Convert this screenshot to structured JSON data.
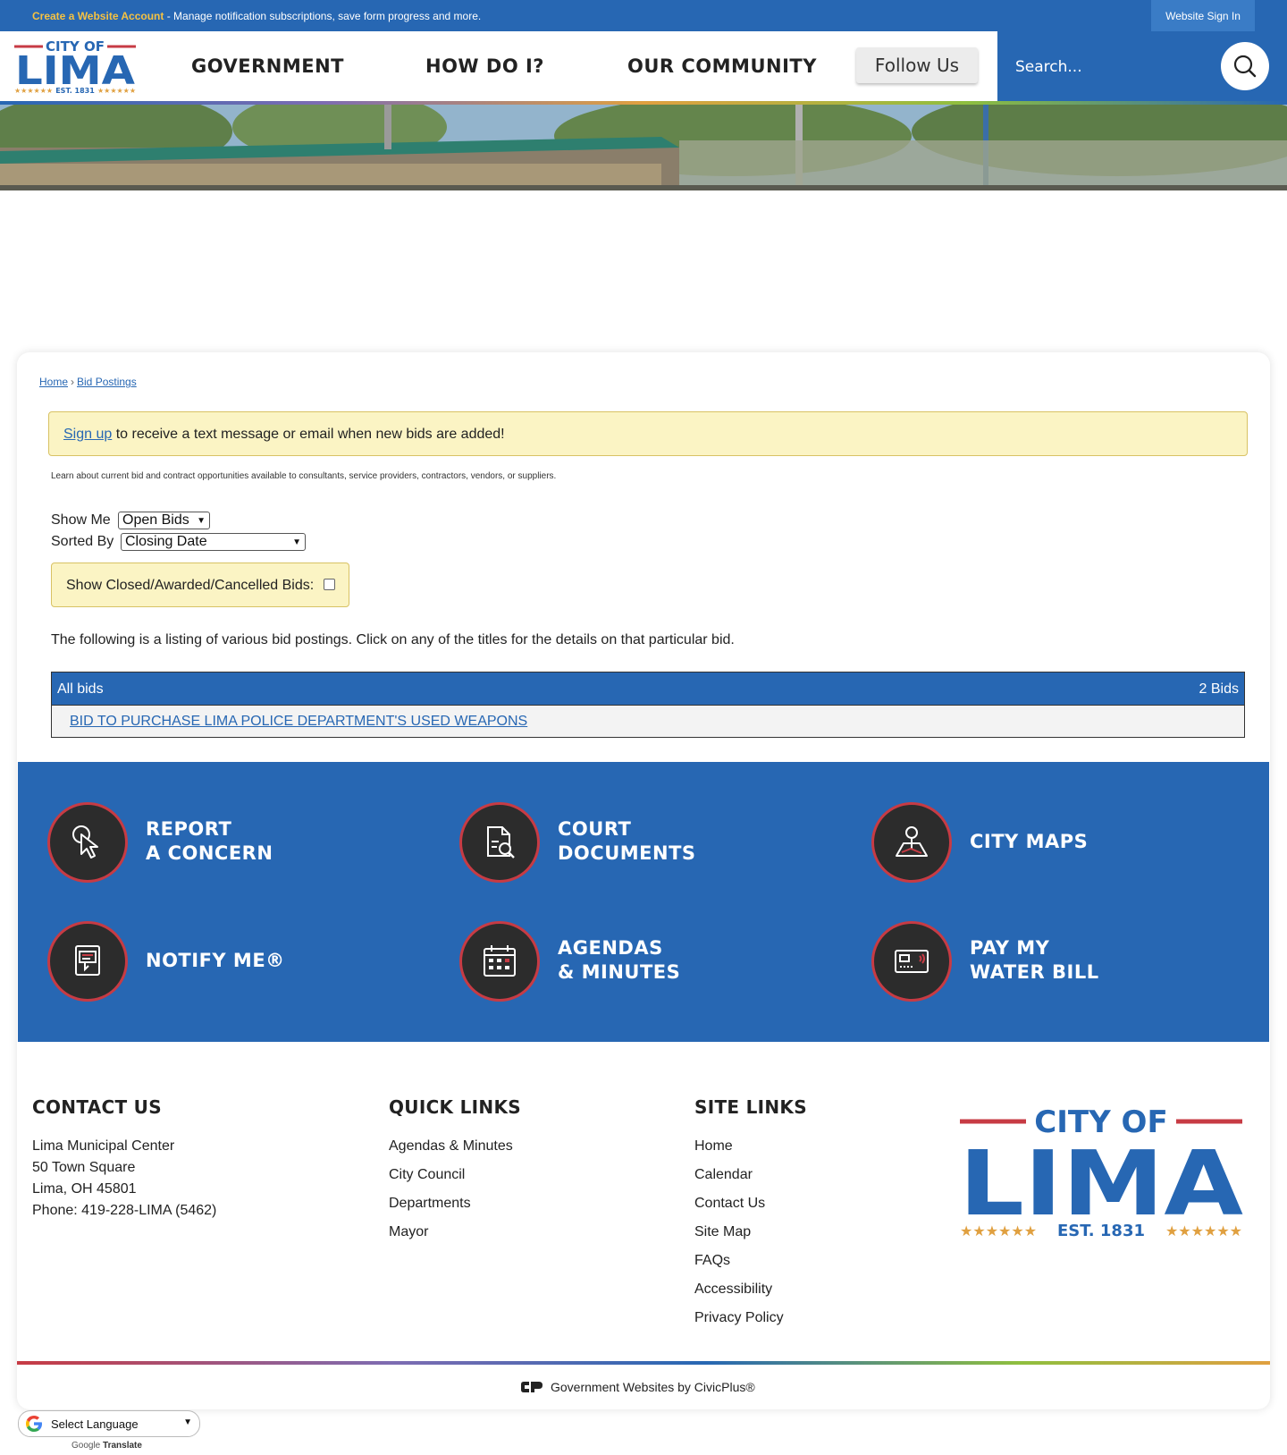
{
  "topbar": {
    "create_link": "Create a Website Account",
    "create_desc": " - Manage notification subscriptions, save form progress and more.",
    "sign_in": "Website Sign In"
  },
  "header": {
    "logo": {
      "top": "CITY OF",
      "main": "LIMA",
      "est": "EST. 1831"
    },
    "nav": [
      "GOVERNMENT",
      "HOW DO I?",
      "OUR COMMUNITY"
    ],
    "follow_us": "Follow Us",
    "search_placeholder": "Search..."
  },
  "breadcrumb": {
    "home": "Home",
    "sep": "›",
    "current": "Bid Postings"
  },
  "alert": {
    "link": "Sign up",
    "text": " to receive a text message or email when new bids are added!"
  },
  "intro": "Learn about current bid and contract opportunities available to consultants, service providers, contractors, vendors, or suppliers.",
  "filters": {
    "show_me_label": "Show Me",
    "show_me_value": "Open Bids",
    "sorted_by_label": "Sorted By",
    "sorted_by_value": "Closing Date",
    "closed_label": "Show Closed/Awarded/Cancelled Bids:"
  },
  "listing_text": "The following is a listing of various bid postings. Click on any of the titles for the details on that particular bid.",
  "table": {
    "header_left": "All bids",
    "header_right": "2 Bids",
    "rows": [
      "BID TO PURCHASE LIMA POLICE DEPARTMENT'S USED WEAPONS"
    ]
  },
  "tiles": [
    {
      "line1": "REPORT",
      "line2": "A CONCERN",
      "icon": "cursor-click-icon"
    },
    {
      "line1": "COURT",
      "line2": "DOCUMENTS",
      "icon": "document-search-icon"
    },
    {
      "line1": "CITY MAPS",
      "line2": "",
      "icon": "map-pin-icon"
    },
    {
      "line1": "NOTIFY ME®",
      "line2": "",
      "icon": "notification-icon"
    },
    {
      "line1": "AGENDAS",
      "line2": "& MINUTES",
      "icon": "calendar-icon"
    },
    {
      "line1": "PAY MY",
      "line2": "WATER BILL",
      "icon": "card-icon"
    }
  ],
  "footer": {
    "contact": {
      "title": "CONTACT US",
      "lines": [
        "Lima Municipal Center",
        "50 Town Square",
        "Lima, OH 45801",
        "Phone: 419-228-LIMA (5462)"
      ]
    },
    "quick_links": {
      "title": "QUICK LINKS",
      "items": [
        "Agendas & Minutes",
        "City Council",
        "Departments",
        "Mayor"
      ]
    },
    "site_links": {
      "title": "SITE LINKS",
      "items": [
        "Home",
        "Calendar",
        "Contact Us",
        "Site Map",
        "FAQs",
        "Accessibility",
        "Privacy Policy"
      ]
    },
    "civicplus": "Government Websites by CivicPlus®"
  },
  "translate": {
    "select": "Select Language",
    "powered_prefix": "Google",
    "powered_word": "Translate"
  },
  "colors": {
    "brand_blue": "#2767b3",
    "accent_red": "#c73b44",
    "gold": "#e0a040",
    "alert_bg": "#fbf4c4"
  }
}
